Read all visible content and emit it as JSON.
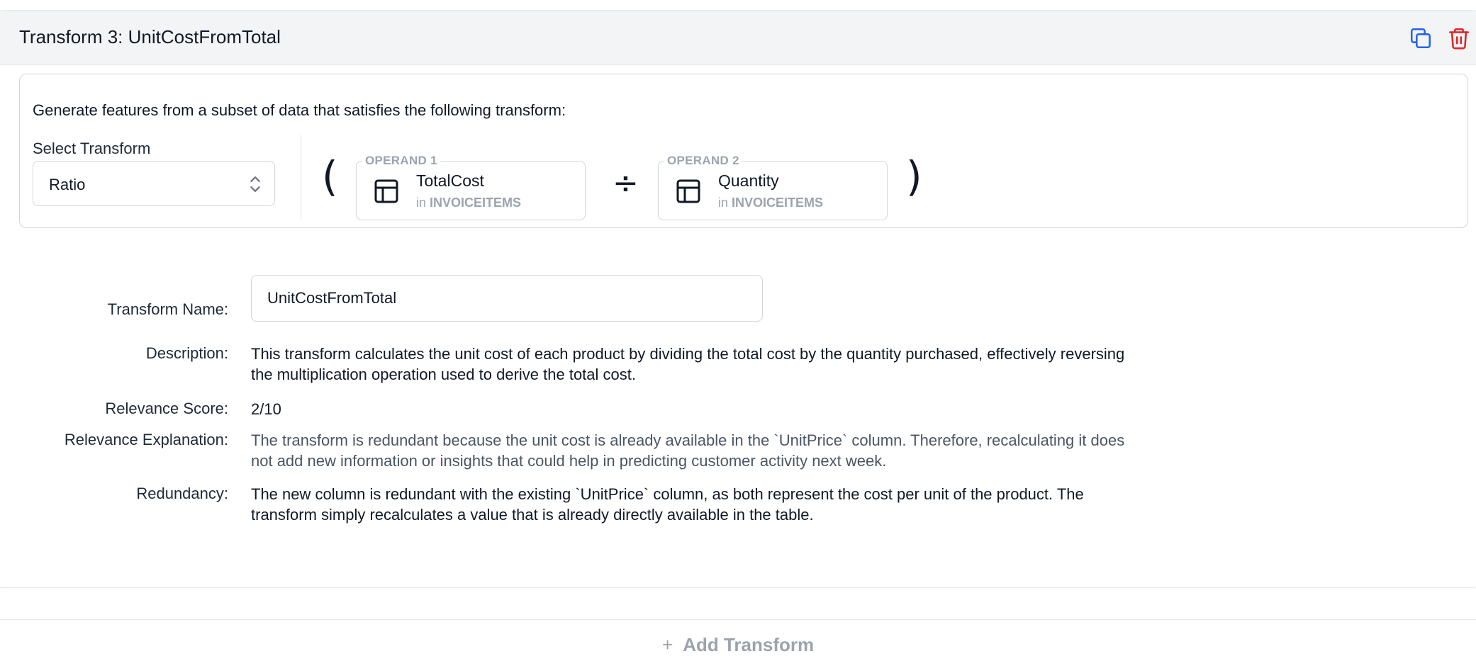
{
  "header": {
    "title": "Transform 3: UnitCostFromTotal",
    "copy_icon": "copy-icon",
    "trash_icon": "trash-icon",
    "trash_color": "#dc2626",
    "copy_color": "#2563eb"
  },
  "transform": {
    "intro": "Generate features from a subset of data that satisfies the following transform:",
    "select_label": "Select Transform",
    "select_value": "Ratio",
    "open_paren": "(",
    "close_paren": ")",
    "operator": "÷",
    "operand1": {
      "legend": "OPERAND 1",
      "name": "TotalCost",
      "in_prefix": "in",
      "table": "INVOICEITEMS"
    },
    "operand2": {
      "legend": "OPERAND 2",
      "name": "Quantity",
      "in_prefix": "in",
      "table": "INVOICEITEMS"
    }
  },
  "details": {
    "name_label": "Transform Name:",
    "name_value": "UnitCostFromTotal",
    "description_label": "Description:",
    "description_value": "This transform calculates the unit cost of each product by dividing the total cost by the quantity purchased, effectively reversing the multiplication operation used to derive the total cost.",
    "score_label": "Relevance Score:",
    "score_value": "2/10",
    "explanation_label": "Relevance Explanation:",
    "explanation_value": "The transform is redundant because the unit cost is already available in the `UnitPrice` column. Therefore, recalculating it does not add new information or insights that could help in predicting customer activity next week.",
    "redundancy_label": "Redundancy:",
    "redundancy_value": "The new column is redundant with the existing `UnitPrice` column, as both represent the cost per unit of the product. The transform simply recalculates a value that is already directly available in the table."
  },
  "footer": {
    "add_icon": "plus-icon",
    "add_label": "Add Transform"
  }
}
